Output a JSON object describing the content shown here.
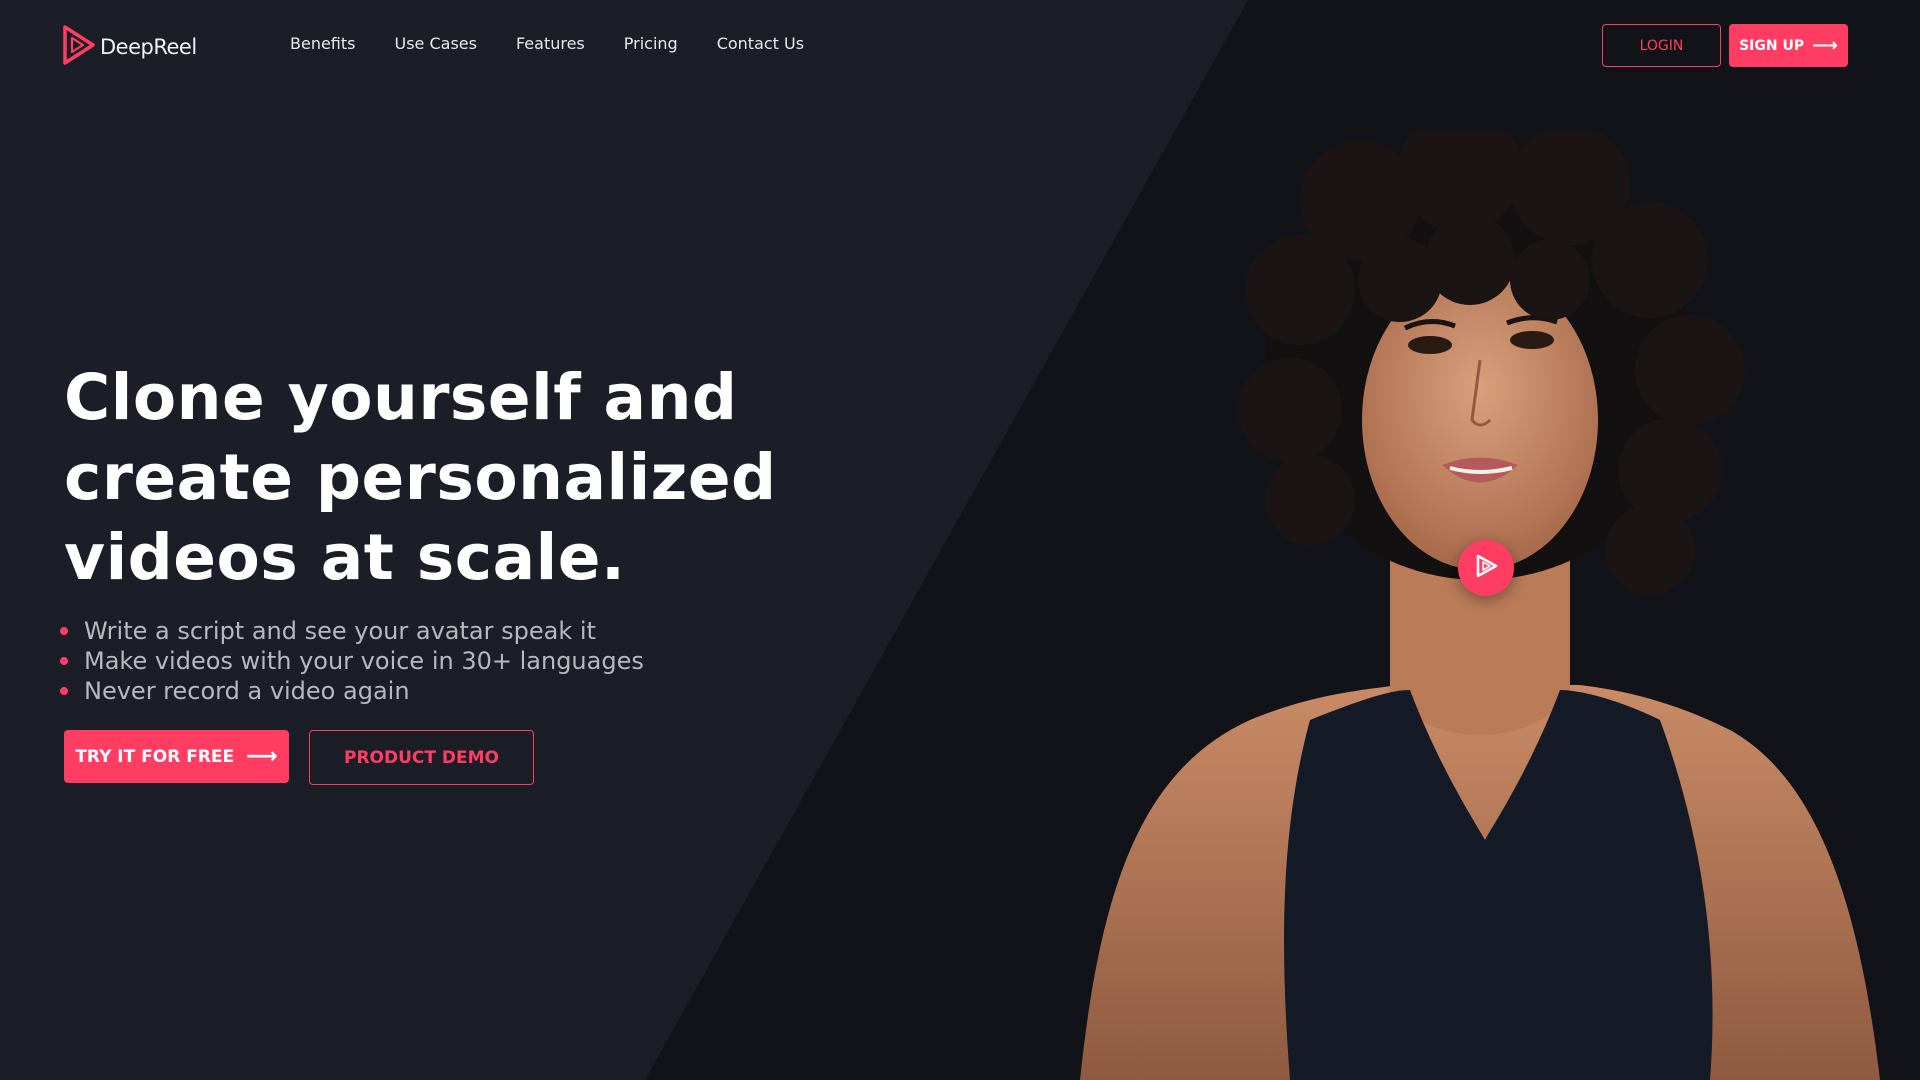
{
  "brand": {
    "name": "DeepReel",
    "logo_icon": "play-triangle-logo-icon",
    "accent_color": "#ff3d63"
  },
  "nav": {
    "items": [
      {
        "label": "Benefits"
      },
      {
        "label": "Use Cases"
      },
      {
        "label": "Features"
      },
      {
        "label": "Pricing"
      },
      {
        "label": "Contact Us"
      }
    ]
  },
  "auth": {
    "login_label": "LOGIN",
    "signup_label": "SIGN UP",
    "signup_icon": "arrow-right-icon"
  },
  "hero": {
    "title_line1": "Clone yourself and",
    "title_line2": "create personalized",
    "title_line3": "videos at scale.",
    "bullets": [
      {
        "text": "Write a script and see your avatar speak it"
      },
      {
        "text": "Make videos with your voice in 30+ languages"
      },
      {
        "text": "Never record a video again"
      }
    ],
    "cta_primary": "TRY IT FOR FREE",
    "cta_primary_icon": "arrow-right-icon",
    "cta_secondary": "PRODUCT DEMO"
  },
  "media": {
    "play_icon": "play-icon",
    "colors": {
      "page_background": "#1b1e26",
      "diagonal_panel": "#111318"
    }
  }
}
